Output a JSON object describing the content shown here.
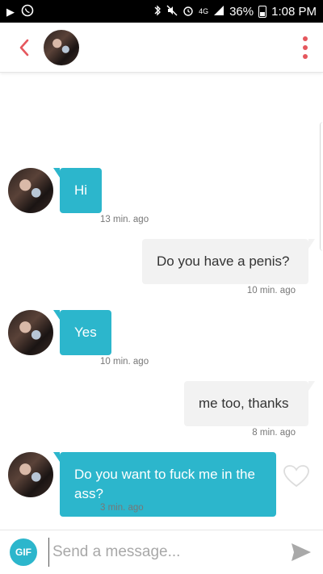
{
  "status_bar": {
    "battery": "36%",
    "time": "1:08 PM",
    "icons": [
      "play-icon",
      "whatsapp-icon",
      "bluetooth-icon",
      "mute-icon",
      "alarm-icon",
      "4g-icon",
      "signal-icon",
      "battery-icon"
    ],
    "network_label": "4G"
  },
  "header": {
    "back_icon": "chevron-left-icon",
    "menu_icon": "more-vertical-icon"
  },
  "messages": [
    {
      "direction": "in",
      "text": "Hi",
      "time": "13 min. ago"
    },
    {
      "direction": "out",
      "text": "Do you have a penis?",
      "time": "10 min. ago"
    },
    {
      "direction": "in",
      "text": "Yes",
      "time": "10 min. ago"
    },
    {
      "direction": "out",
      "text": "me too, thanks",
      "time": "8 min. ago"
    },
    {
      "direction": "in",
      "text": "Do you want to fuck me in the ass?",
      "time": "3 min. ago"
    }
  ],
  "composer": {
    "gif_label": "GIF",
    "placeholder": "Send a message...",
    "send_icon": "send-icon"
  },
  "colors": {
    "accent": "#2cb6cc",
    "brand_red": "#e5575d",
    "outgoing_bubble": "#f2f2f2",
    "status_bar": "#000000"
  }
}
